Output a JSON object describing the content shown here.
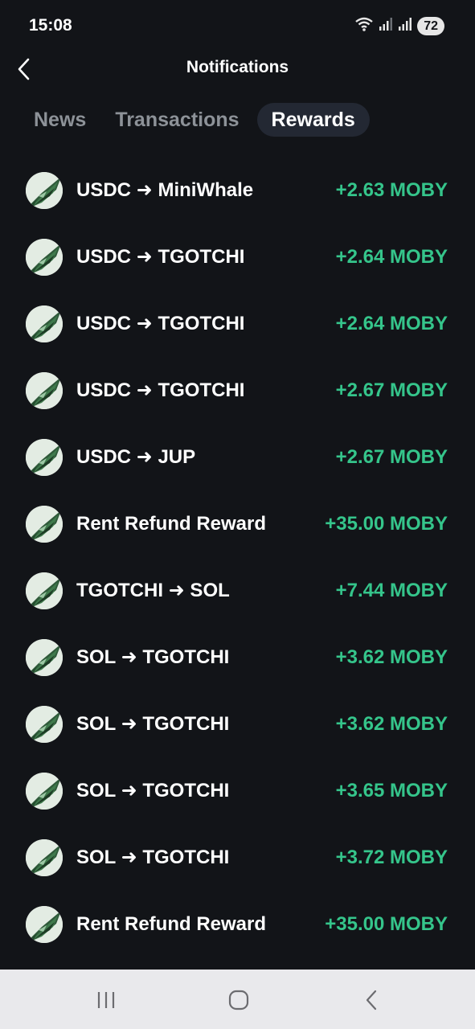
{
  "status_bar": {
    "time": "15:08",
    "battery": "72",
    "icons": [
      "wifi-icon",
      "signal-icon",
      "signal-icon",
      "battery-icon"
    ]
  },
  "header": {
    "title": "Notifications",
    "back_icon": "chevron-left-icon"
  },
  "tabs": [
    {
      "label": "News",
      "active": false
    },
    {
      "label": "Transactions",
      "active": false
    },
    {
      "label": "Rewards",
      "active": true
    }
  ],
  "rewards": [
    {
      "title": "USDC ➜ MiniWhale",
      "amount": "+2.63 MOBY"
    },
    {
      "title": "USDC ➜ TGOTCHI",
      "amount": "+2.64 MOBY"
    },
    {
      "title": "USDC ➜ TGOTCHI",
      "amount": "+2.64 MOBY"
    },
    {
      "title": "USDC ➜ TGOTCHI",
      "amount": "+2.67 MOBY"
    },
    {
      "title": "USDC ➜ JUP",
      "amount": "+2.67 MOBY"
    },
    {
      "title": "Rent Refund Reward",
      "amount": "+35.00 MOBY"
    },
    {
      "title": "TGOTCHI ➜ SOL",
      "amount": "+7.44 MOBY"
    },
    {
      "title": "SOL ➜ TGOTCHI",
      "amount": "+3.62 MOBY"
    },
    {
      "title": "SOL ➜ TGOTCHI",
      "amount": "+3.62 MOBY"
    },
    {
      "title": "SOL ➜ TGOTCHI",
      "amount": "+3.65 MOBY"
    },
    {
      "title": "SOL ➜ TGOTCHI",
      "amount": "+3.72 MOBY"
    },
    {
      "title": "Rent Refund Reward",
      "amount": "+35.00 MOBY"
    }
  ],
  "nav_bar": {
    "icons": [
      "recent-apps-icon",
      "home-icon",
      "back-icon"
    ]
  },
  "colors": {
    "background": "#121418",
    "accent_green": "#35c58b",
    "tab_inactive": "#8d9298",
    "tab_active_bg": "#232833",
    "nav_bar_bg": "#e9e9ec"
  }
}
